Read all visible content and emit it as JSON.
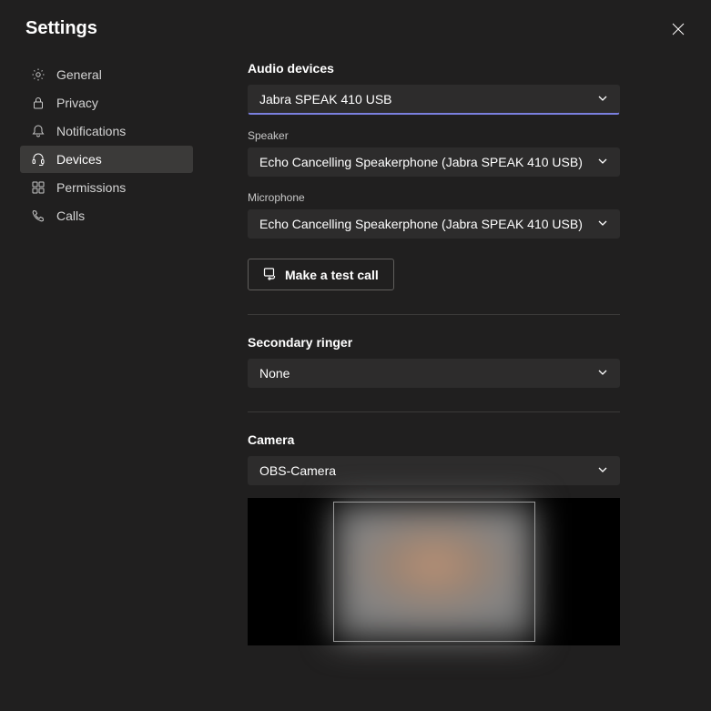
{
  "header": {
    "title": "Settings"
  },
  "sidebar": {
    "items": [
      {
        "label": "General"
      },
      {
        "label": "Privacy"
      },
      {
        "label": "Notifications"
      },
      {
        "label": "Devices"
      },
      {
        "label": "Permissions"
      },
      {
        "label": "Calls"
      }
    ]
  },
  "content": {
    "audio_devices_label": "Audio devices",
    "audio_devices_value": "Jabra SPEAK 410 USB",
    "speaker_label": "Speaker",
    "speaker_value": "Echo Cancelling Speakerphone (Jabra SPEAK 410 USB)",
    "microphone_label": "Microphone",
    "microphone_value": "Echo Cancelling Speakerphone (Jabra SPEAK 410 USB)",
    "test_call_label": "Make a test call",
    "secondary_ringer_label": "Secondary ringer",
    "secondary_ringer_value": "None",
    "camera_label": "Camera",
    "camera_value": "OBS-Camera"
  }
}
